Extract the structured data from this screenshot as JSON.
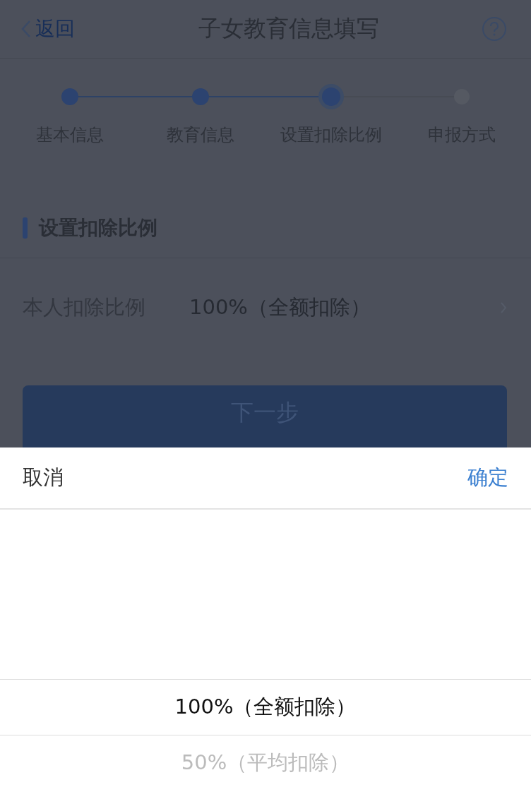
{
  "nav": {
    "back": "返回",
    "title": "子女教育信息填写"
  },
  "steps": [
    {
      "label": "基本信息",
      "reached": true,
      "current": false
    },
    {
      "label": "教育信息",
      "reached": true,
      "current": false
    },
    {
      "label": "设置扣除比例",
      "reached": true,
      "current": true
    },
    {
      "label": "申报方式",
      "reached": false,
      "current": false
    }
  ],
  "section": {
    "title": "设置扣除比例"
  },
  "field": {
    "label": "本人扣除比例",
    "value": "100%（全额扣除）"
  },
  "next_button": "下一步",
  "picker": {
    "cancel": "取消",
    "confirm": "确定",
    "options": [
      {
        "label": "100%（全额扣除）",
        "selected": true
      },
      {
        "label": "50%（平均扣除）",
        "selected": false
      }
    ]
  }
}
